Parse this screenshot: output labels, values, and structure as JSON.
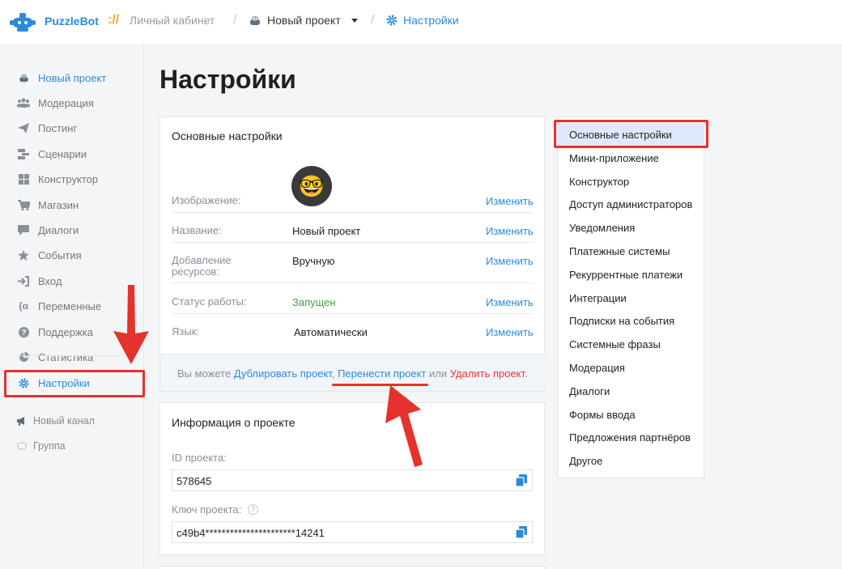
{
  "header": {
    "brand": "PuzzleBot",
    "brand_sep": "://",
    "crumb_cabinet": "Личный кабинет",
    "crumb_project": "Новый проект",
    "crumb_settings": "Настройки"
  },
  "sidebar": {
    "items": [
      {
        "label": "Новый проект",
        "icon": "robot-icon"
      },
      {
        "label": "Модерация",
        "icon": "users-icon"
      },
      {
        "label": "Постинг",
        "icon": "paper-plane-icon"
      },
      {
        "label": "Сценарии",
        "icon": "sitemap-icon"
      },
      {
        "label": "Конструктор",
        "icon": "grid-icon"
      },
      {
        "label": "Магазин",
        "icon": "cart-icon"
      },
      {
        "label": "Диалоги",
        "icon": "chat-icon"
      },
      {
        "label": "События",
        "icon": "star-icon"
      },
      {
        "label": "Вход",
        "icon": "sign-in-icon"
      },
      {
        "label": "Переменные",
        "icon": "variable-icon"
      },
      {
        "label": "Поддержка",
        "icon": "help-icon"
      },
      {
        "label": "Статистика",
        "icon": "pie-chart-icon"
      },
      {
        "label": "Настройки",
        "icon": "gear-icon"
      }
    ],
    "sub_items": [
      {
        "label": "Новый канал",
        "icon": "megaphone-icon"
      },
      {
        "label": "Группа",
        "icon": "chat-bubble-icon"
      }
    ]
  },
  "page": {
    "title": "Настройки"
  },
  "main_settings": {
    "title": "Основные настройки",
    "rows": [
      {
        "label": "Изображение:",
        "value": "",
        "action": "Изменить"
      },
      {
        "label": "Название:",
        "value": "Новый проект",
        "action": "Изменить"
      },
      {
        "label": "Добавление ресурсов:",
        "value": "Вручную",
        "action": "Изменить"
      },
      {
        "label": "Статус работы:",
        "value": "Запущен",
        "action": "Изменить"
      },
      {
        "label": "Язык:",
        "value": "Автоматически",
        "action": "Изменить"
      }
    ],
    "avatar_emoji": "🤓",
    "footer": {
      "prefix": "Вы можете ",
      "duplicate": "Дублировать проект",
      "comma": ", ",
      "transfer": "Перенести проект",
      "or": " или ",
      "delete": "Удалить проект",
      "dot": "."
    }
  },
  "project_info": {
    "title": "Информация о проекте",
    "id_label": "ID проекта:",
    "id_value": "578645",
    "key_label": "Ключ проекта:",
    "key_value": "c49b4**********************14241"
  },
  "right_menu": {
    "items": [
      "Основные настройки",
      "Мини-приложение",
      "Конструктор",
      "Доступ администраторов",
      "Уведомления",
      "Платежные системы",
      "Рекуррентные платежи",
      "Интеграции",
      "Подписки на события",
      "Системные фразы",
      "Модерация",
      "Диалоги",
      "Формы ввода",
      "Предложения партнёров",
      "Другое"
    ],
    "active_index": 0
  },
  "colors": {
    "accent": "#2c8bd9",
    "annotation_red": "#e5322d",
    "status_green": "#43a047"
  }
}
